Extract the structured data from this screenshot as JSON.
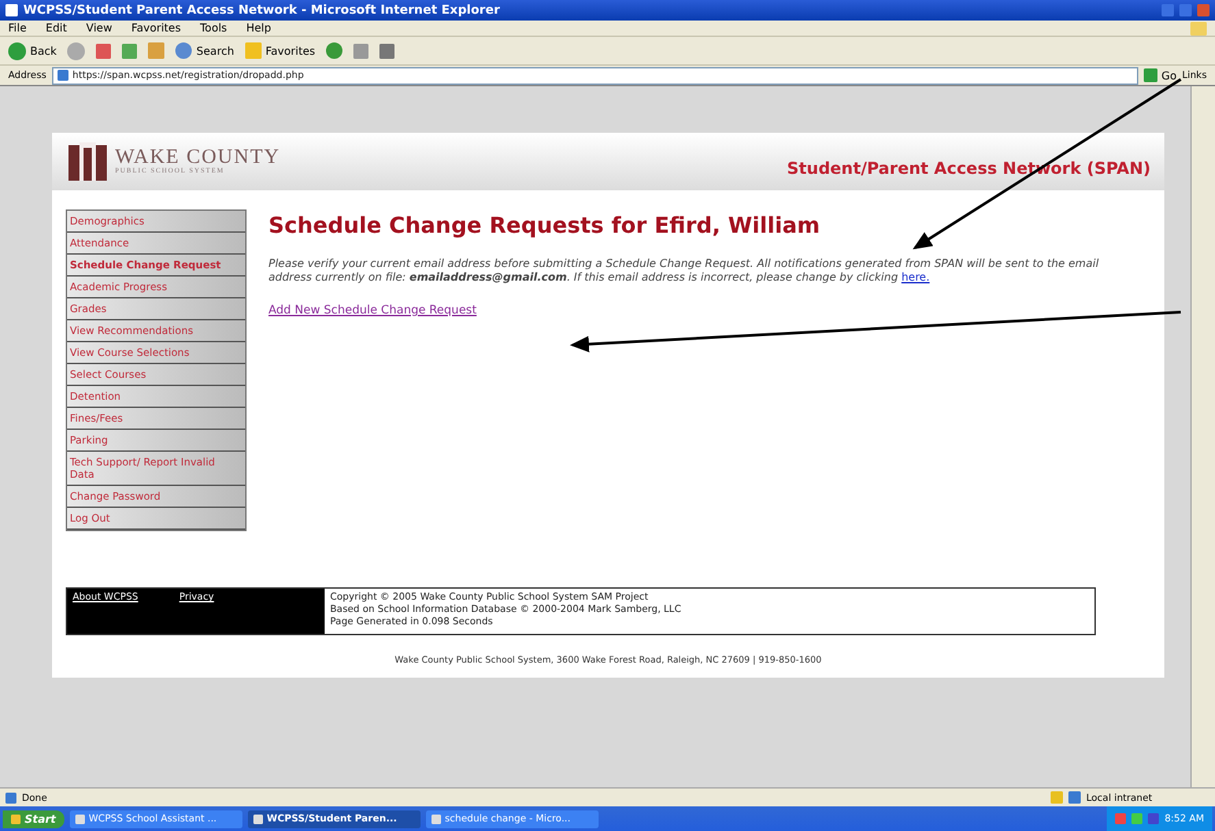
{
  "window": {
    "title": "WCPSS/Student Parent Access Network - Microsoft Internet Explorer"
  },
  "menu": [
    "File",
    "Edit",
    "View",
    "Favorites",
    "Tools",
    "Help"
  ],
  "toolbar": {
    "back": "Back",
    "search": "Search",
    "favorites": "Favorites"
  },
  "address_bar": {
    "label": "Address",
    "url": "https://span.wcpss.net/registration/dropadd.php",
    "go": "Go",
    "links": "Links"
  },
  "header": {
    "logo_title": "WAKE COUNTY",
    "logo_subtitle": "PUBLIC SCHOOL SYSTEM",
    "site_title": "Student/Parent Access Network (SPAN)"
  },
  "sidebar": {
    "items": [
      {
        "label": "Demographics",
        "selected": false
      },
      {
        "label": "Attendance",
        "selected": false
      },
      {
        "label": "Schedule Change Request",
        "selected": true
      },
      {
        "label": "Academic Progress",
        "selected": false
      },
      {
        "label": "Grades",
        "selected": false
      },
      {
        "label": "View Recommendations",
        "selected": false
      },
      {
        "label": "View Course Selections",
        "selected": false
      },
      {
        "label": "Select Courses",
        "selected": false
      },
      {
        "label": "Detention",
        "selected": false
      },
      {
        "label": "Fines/Fees",
        "selected": false
      },
      {
        "label": "Parking",
        "selected": false
      },
      {
        "label": "Tech Support/ Report Invalid Data",
        "selected": false
      },
      {
        "label": "Change Password",
        "selected": false
      },
      {
        "label": "Log Out",
        "selected": false
      }
    ]
  },
  "main": {
    "heading": "Schedule Change Requests for Efird, William",
    "notice": "Please verify your current email address before submitting a Schedule Change Request. All notifications generated from SPAN will be sent to the email address currently on file: **emailaddress@gmail.com**. If this email address is incorrect, please change by clicking ",
    "notice_link": "here.",
    "add_link": "Add New Schedule Change Request"
  },
  "footer": {
    "links": [
      "About WCPSS",
      "Privacy"
    ],
    "lines": [
      "Copyright © 2005 Wake County Public School System SAM Project",
      "Based on School Information Database © 2000-2004 Mark Samberg, LLC",
      "Page Generated in 0.098 Seconds"
    ],
    "address": "Wake County Public School System, 3600 Wake Forest Road, Raleigh, NC 27609 | 919-850-1600"
  },
  "status_bar": {
    "status": "Done",
    "zone": "Local intranet"
  },
  "taskbar": {
    "start": "Start",
    "tasks": [
      {
        "label": "WCPSS School Assistant ...",
        "selected": false
      },
      {
        "label": "WCPSS/Student Paren...",
        "selected": true
      },
      {
        "label": "schedule change - Micro...",
        "selected": false
      }
    ],
    "clock": "8:52 AM"
  }
}
